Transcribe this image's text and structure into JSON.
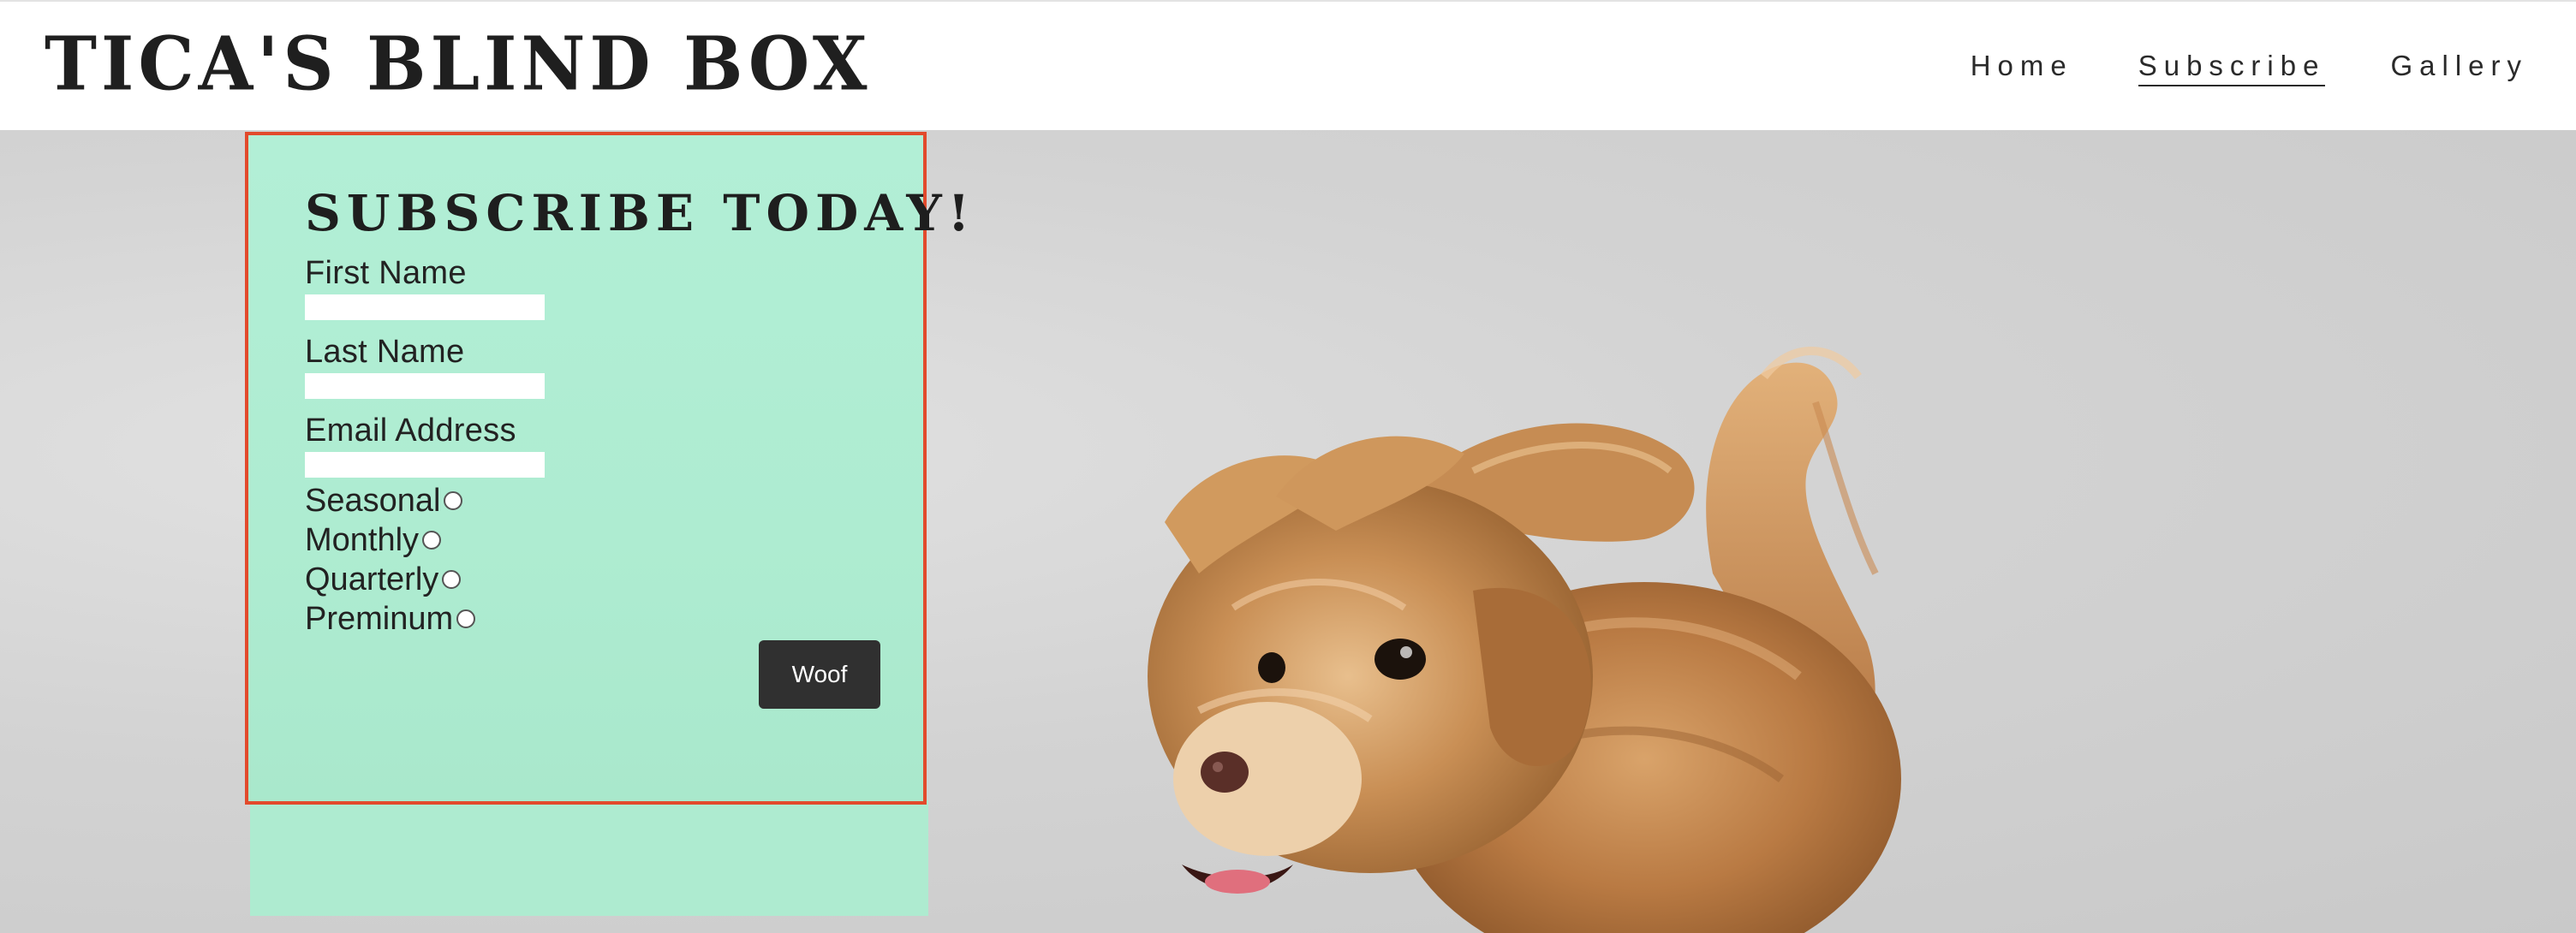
{
  "header": {
    "brand": "TICA'S BLIND BOX",
    "nav": [
      {
        "label": "Home",
        "active": false
      },
      {
        "label": "Subscribe",
        "active": true
      },
      {
        "label": "Gallery",
        "active": false
      }
    ]
  },
  "subscribe": {
    "title": "SUBSCRIBE TODAY!",
    "fields": [
      {
        "label": "First Name",
        "value": ""
      },
      {
        "label": "Last Name",
        "value": ""
      },
      {
        "label": "Email Address",
        "value": ""
      }
    ],
    "plans": [
      "Seasonal",
      "Monthly",
      "Quarterly",
      "Preminum"
    ],
    "submit_label": "Woof"
  },
  "colors": {
    "panel_bg": "#aeebd0",
    "panel_border": "#e24a2c",
    "button_bg": "#303030",
    "header_bg": "#ffffff",
    "text_dark": "#1e1e1e"
  },
  "hero": {
    "image": "dog-photo"
  }
}
